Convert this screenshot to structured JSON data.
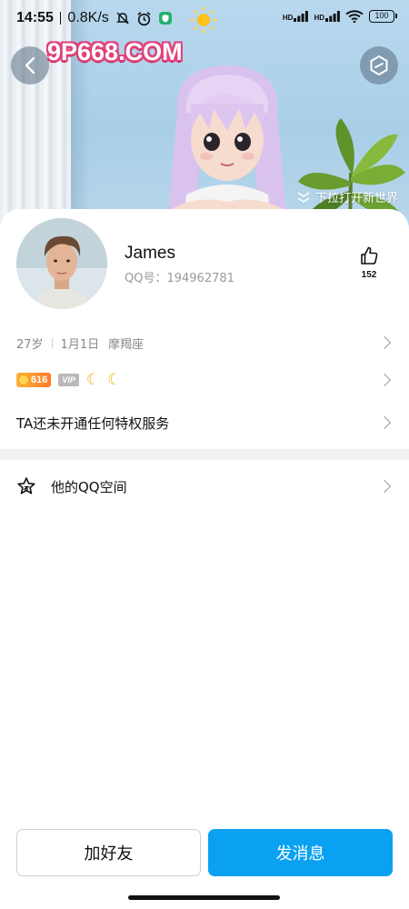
{
  "status_bar": {
    "time": "14:55",
    "network_speed": "0.8K/s",
    "signal_1": "HD",
    "signal_2": "HD",
    "battery": "100"
  },
  "watermark": {
    "text": "9P668.COM"
  },
  "banner": {
    "pull_hint": "下拉打开新世界"
  },
  "profile": {
    "name": "James",
    "qq_label": "QQ号：",
    "qq_number": "194962781",
    "like_count": "152"
  },
  "info": {
    "age": "27岁",
    "birthday": "1月1日",
    "zodiac": "摩羯座"
  },
  "badges": {
    "level": "616",
    "vip": "VIP"
  },
  "privilege": {
    "text": "TA还未开通任何特权服务"
  },
  "qzone": {
    "label": "他的QQ空间"
  },
  "actions": {
    "add_friend": "加好友",
    "send_message": "发消息"
  },
  "colors": {
    "primary": "#0aa1f3",
    "level_badge": "#ff8a26",
    "watermark": "#e0417a"
  }
}
